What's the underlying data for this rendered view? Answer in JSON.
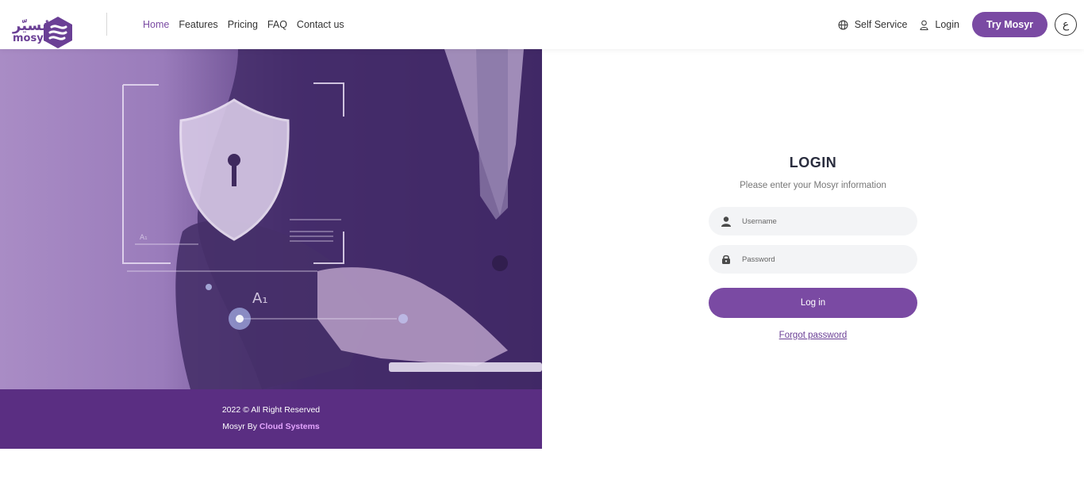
{
  "header": {
    "logo_ar": "مُسيّر",
    "logo_en": "mosyr",
    "nav": [
      "Home",
      "Features",
      "Pricing",
      "FAQ",
      "Contact us"
    ],
    "active_nav": "Home",
    "self_service": "Self Service",
    "login": "Login",
    "try_button": "Try Mosyr",
    "lang_toggle": "ع"
  },
  "footer": {
    "copyright": "2022 © All Right Reserved",
    "by_prefix": "Mosyr By",
    "by_brand": "Cloud Systems"
  },
  "login": {
    "title": "LOGIN",
    "subtitle": "Please enter your Mosyr information",
    "username_placeholder": "Username",
    "password_placeholder": "Password",
    "submit": "Log in",
    "forgot": "Forgot password"
  },
  "colors": {
    "accent": "#7a4aa3",
    "footer_bg": "#5a2e82",
    "brand_link": "#e4a5ff"
  }
}
